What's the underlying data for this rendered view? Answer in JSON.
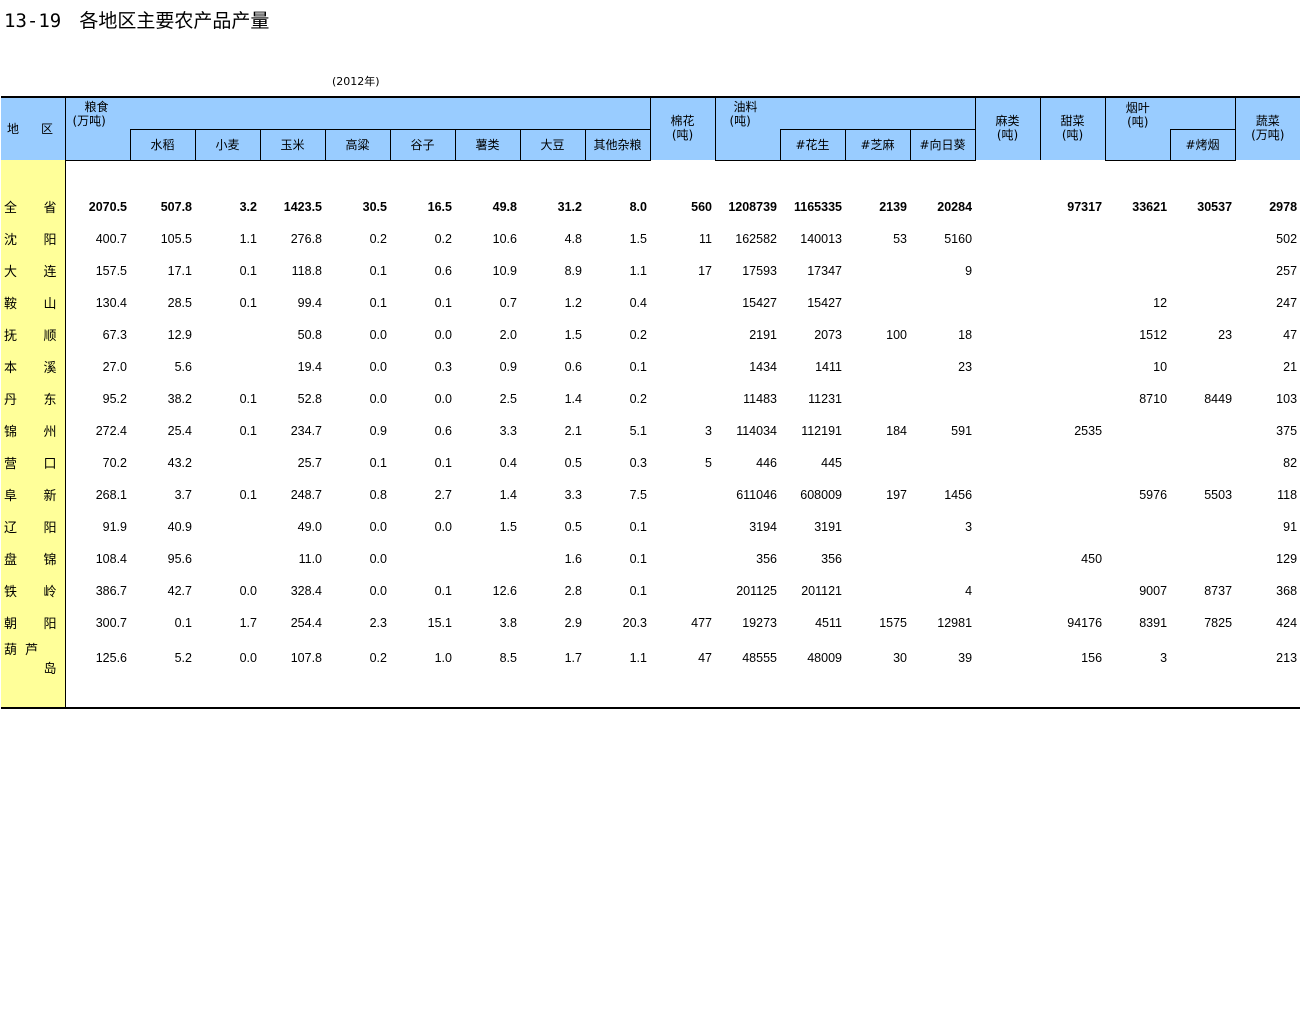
{
  "title": {
    "number": "13-19",
    "text": "各地区主要农产品产量"
  },
  "year_note": "(2012年)",
  "headers": {
    "region": [
      "地",
      "区"
    ],
    "grain": [
      "粮食",
      "(万吨)"
    ],
    "grain_sub": [
      "水稻",
      "小麦",
      "玉米",
      "高粱",
      "谷子",
      "薯类",
      "大豆",
      "其他杂粮"
    ],
    "cotton": [
      "棉花",
      "(吨)"
    ],
    "oil": [
      "油料",
      "(吨)"
    ],
    "oil_sub": [
      "#花生",
      "#芝麻",
      "#向日葵"
    ],
    "hemp": [
      "麻类",
      "(吨)"
    ],
    "beet": [
      "甜菜",
      "(吨)"
    ],
    "tobacco": [
      "烟叶",
      "(吨)"
    ],
    "tobacco_sub": [
      "#烤烟"
    ],
    "veg": [
      "蔬菜",
      "(万吨)"
    ]
  },
  "rows": [
    {
      "region": [
        "全",
        "省"
      ],
      "v": [
        "2070.5",
        "507.8",
        "3.2",
        "1423.5",
        "30.5",
        "16.5",
        "49.8",
        "31.2",
        "8.0",
        "560",
        "1208739",
        "1165335",
        "2139",
        "20284",
        "",
        "97317",
        "33621",
        "30537",
        "2978"
      ]
    },
    {
      "region": [
        "沈",
        "阳"
      ],
      "v": [
        "400.7",
        "105.5",
        "1.1",
        "276.8",
        "0.2",
        "0.2",
        "10.6",
        "4.8",
        "1.5",
        "11",
        "162582",
        "140013",
        "53",
        "5160",
        "",
        "",
        "",
        "",
        "502"
      ]
    },
    {
      "region": [
        "大",
        "连"
      ],
      "v": [
        "157.5",
        "17.1",
        "0.1",
        "118.8",
        "0.1",
        "0.6",
        "10.9",
        "8.9",
        "1.1",
        "17",
        "17593",
        "17347",
        "",
        "9",
        "",
        "",
        "",
        "",
        "257"
      ]
    },
    {
      "region": [
        "鞍",
        "山"
      ],
      "v": [
        "130.4",
        "28.5",
        "0.1",
        "99.4",
        "0.1",
        "0.1",
        "0.7",
        "1.2",
        "0.4",
        "",
        "15427",
        "15427",
        "",
        "",
        "",
        "",
        "12",
        "",
        "247"
      ]
    },
    {
      "region": [
        "抚",
        "顺"
      ],
      "v": [
        "67.3",
        "12.9",
        "",
        "50.8",
        "0.0",
        "0.0",
        "2.0",
        "1.5",
        "0.2",
        "",
        "2191",
        "2073",
        "100",
        "18",
        "",
        "",
        "1512",
        "23",
        "47"
      ]
    },
    {
      "region": [
        "本",
        "溪"
      ],
      "v": [
        "27.0",
        "5.6",
        "",
        "19.4",
        "0.0",
        "0.3",
        "0.9",
        "0.6",
        "0.1",
        "",
        "1434",
        "1411",
        "",
        "23",
        "",
        "",
        "10",
        "",
        "21"
      ]
    },
    {
      "region": [
        "丹",
        "东"
      ],
      "v": [
        "95.2",
        "38.2",
        "0.1",
        "52.8",
        "0.0",
        "0.0",
        "2.5",
        "1.4",
        "0.2",
        "",
        "11483",
        "11231",
        "",
        "",
        "",
        "",
        "8710",
        "8449",
        "103"
      ]
    },
    {
      "region": [
        "锦",
        "州"
      ],
      "v": [
        "272.4",
        "25.4",
        "0.1",
        "234.7",
        "0.9",
        "0.6",
        "3.3",
        "2.1",
        "5.1",
        "3",
        "114034",
        "112191",
        "184",
        "591",
        "",
        "2535",
        "",
        "",
        "375"
      ]
    },
    {
      "region": [
        "营",
        "口"
      ],
      "v": [
        "70.2",
        "43.2",
        "",
        "25.7",
        "0.1",
        "0.1",
        "0.4",
        "0.5",
        "0.3",
        "5",
        "446",
        "445",
        "",
        "",
        "",
        "",
        "",
        "",
        "82"
      ]
    },
    {
      "region": [
        "阜",
        "新"
      ],
      "v": [
        "268.1",
        "3.7",
        "0.1",
        "248.7",
        "0.8",
        "2.7",
        "1.4",
        "3.3",
        "7.5",
        "",
        "611046",
        "608009",
        "197",
        "1456",
        "",
        "",
        "5976",
        "5503",
        "118"
      ]
    },
    {
      "region": [
        "辽",
        "阳"
      ],
      "v": [
        "91.9",
        "40.9",
        "",
        "49.0",
        "0.0",
        "0.0",
        "1.5",
        "0.5",
        "0.1",
        "",
        "3194",
        "3191",
        "",
        "3",
        "",
        "",
        "",
        "",
        "91"
      ]
    },
    {
      "region": [
        "盘",
        "锦"
      ],
      "v": [
        "108.4",
        "95.6",
        "",
        "11.0",
        "0.0",
        "",
        "",
        "1.6",
        "0.1",
        "",
        "356",
        "356",
        "",
        "",
        "",
        "450",
        "",
        "",
        "129"
      ]
    },
    {
      "region": [
        "铁",
        "岭"
      ],
      "v": [
        "386.7",
        "42.7",
        "0.0",
        "328.4",
        "0.0",
        "0.1",
        "12.6",
        "2.8",
        "0.1",
        "",
        "201125",
        "201121",
        "",
        "4",
        "",
        "",
        "9007",
        "8737",
        "368"
      ]
    },
    {
      "region": [
        "朝",
        "阳"
      ],
      "v": [
        "300.7",
        "0.1",
        "1.7",
        "254.4",
        "2.3",
        "15.1",
        "3.8",
        "2.9",
        "20.3",
        "477",
        "19273",
        "4511",
        "1575",
        "12981",
        "",
        "94176",
        "8391",
        "7825",
        "424"
      ]
    },
    {
      "region": [
        "葫芦",
        "岛"
      ],
      "v": [
        "125.6",
        "5.2",
        "0.0",
        "107.8",
        "0.2",
        "1.0",
        "8.5",
        "1.7",
        "1.1",
        "47",
        "48555",
        "48009",
        "30",
        "39",
        "",
        "156",
        "3",
        "",
        "213"
      ]
    }
  ]
}
